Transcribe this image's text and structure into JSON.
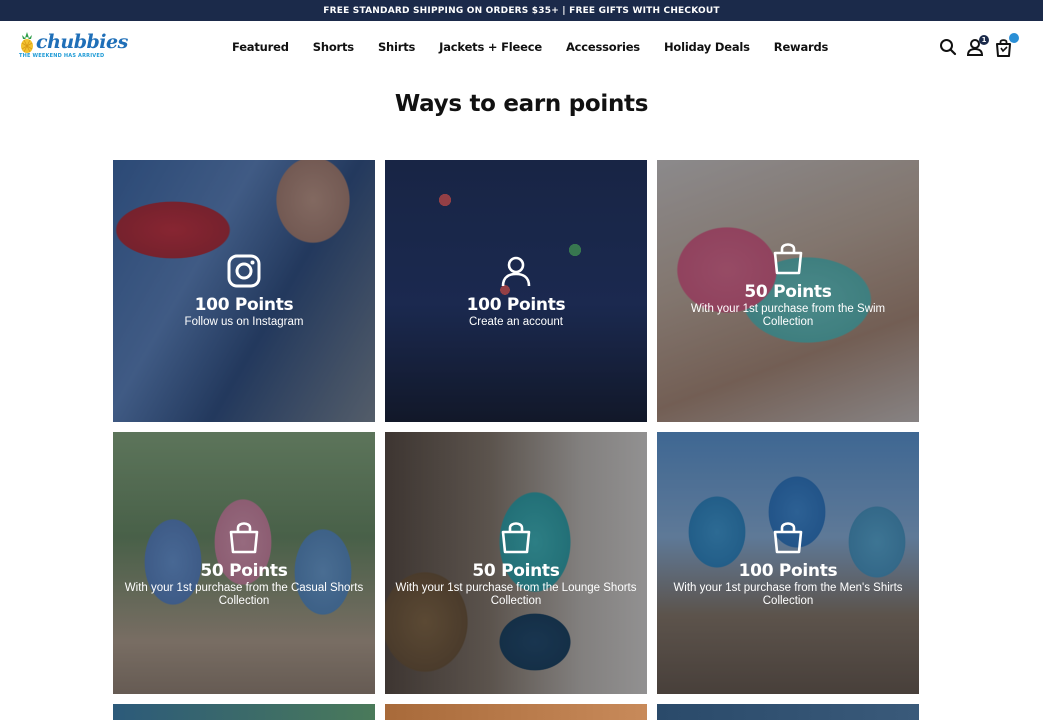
{
  "announcement": "FREE STANDARD SHIPPING ON ORDERS $35+ | FREE GIFTS WITH CHECKOUT",
  "brand": {
    "name": "chubbies",
    "tagline": "THE WEEKEND HAS ARRIVED",
    "colors": {
      "navy": "#1b2a4a",
      "blue": "#1f6fb8",
      "accent": "#2a8fd6"
    }
  },
  "nav": {
    "items": [
      "Featured",
      "Shorts",
      "Shirts",
      "Jackets + Fleece",
      "Accessories",
      "Holiday Deals",
      "Rewards"
    ]
  },
  "header_icons": {
    "search": "search-icon",
    "account": "user-icon",
    "account_badge": "1",
    "cart": "shopping-bag-icon"
  },
  "page": {
    "title": "Ways to earn points"
  },
  "tiles": [
    {
      "points": "100 Points",
      "description": "Follow us on Instagram",
      "icon": "instagram-icon"
    },
    {
      "points": "100 Points",
      "description": "Create an account",
      "icon": "user-icon"
    },
    {
      "points": "50 Points",
      "description": "With your 1st purchase from the Swim Collection",
      "icon": "shopping-bag-icon"
    },
    {
      "points": "50 Points",
      "description": "With your 1st purchase from the Casual Shorts Collection",
      "icon": "shopping-bag-icon"
    },
    {
      "points": "50 Points",
      "description": "With your 1st purchase from the Lounge Shorts Collection",
      "icon": "shopping-bag-icon"
    },
    {
      "points": "100 Points",
      "description": "With your 1st purchase from the Men's Shirts Collection",
      "icon": "shopping-bag-icon"
    }
  ]
}
